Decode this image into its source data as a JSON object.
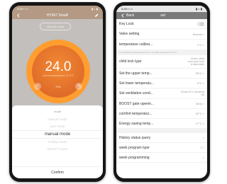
{
  "left": {
    "status": {
      "time": "9:28 ▪ ▪ ◐",
      "icons": "▮ ◐ ▮"
    },
    "title": "HY367 SmaR",
    "mode_badge": "Manual mode",
    "set_temp": "24.0",
    "current_temp": "Current temperature: 21.0°C",
    "percent": "75%",
    "sheet": {
      "title": "mode",
      "options": [
        "manual mode",
        "auto mode",
        "manual mode",
        "holiday mode",
        "BOOST mode"
      ],
      "confirm": "Confirm"
    }
  },
  "right": {
    "status": {
      "time": "9:28 ▪ ▪ ◐",
      "icons": "▮ ◐ ▮"
    },
    "title": "set",
    "back_label": "Back",
    "rows1": [
      {
        "label": "Key Lock",
        "value": ""
      },
      {
        "label": "Valve setting",
        "value": "Normal >"
      },
      {
        "label": "temperature calibra...",
        "value": "1°C >"
      }
    ],
    "notice": "The following contents need to be set after a password is set",
    "rows2": [
      {
        "label": "child lock type",
        "value": "Close child\nlock and lock\nit internally"
      },
      {
        "label": "Set the upper temp...",
        "value": "35°C >"
      },
      {
        "label": "Set lower temperatu...",
        "value": "5°C >"
      },
      {
        "label": "Set ventilation cond...",
        "value": "Close,5°C,10minut\nes"
      },
      {
        "label": "BOOST gate openin...",
        "value": "300s >"
      },
      {
        "label": "comfort temperatur...",
        "value": "22°C >"
      },
      {
        "label": "Energy saving temp...",
        "value": "17°C >"
      }
    ],
    "rows3": [
      {
        "label": "History status query",
        "value": ">"
      },
      {
        "label": "week program type",
        "value": "7 >"
      },
      {
        "label": "week programming",
        "value": ">"
      }
    ]
  }
}
